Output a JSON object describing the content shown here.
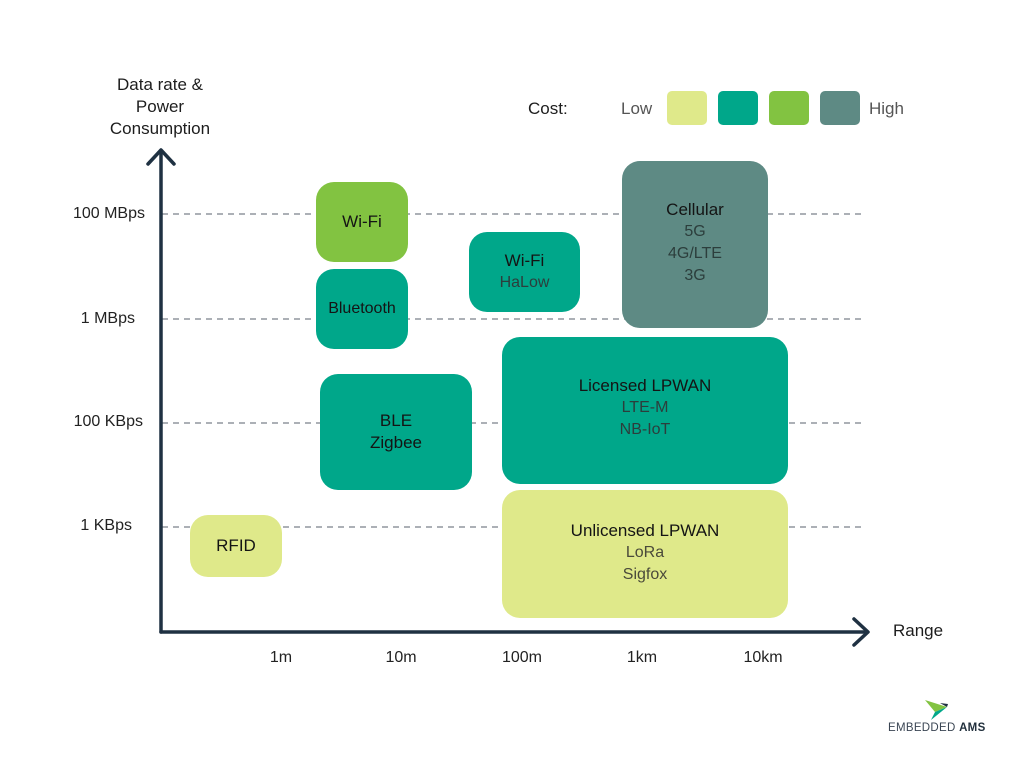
{
  "axes": {
    "y_label": [
      "Data rate &",
      "Power",
      "Consumption"
    ],
    "x_label": "Range",
    "y_ticks": [
      "100 MBps",
      "1 MBps",
      "100 KBps",
      "1 KBps"
    ],
    "x_ticks": [
      "1m",
      "10m",
      "100m",
      "1km",
      "10km"
    ]
  },
  "legend": {
    "title": "Cost:",
    "low_label": "Low",
    "high_label": "High",
    "colors": [
      "#dfe98a",
      "#00a78a",
      "#82c341",
      "#5e8a84"
    ]
  },
  "technologies": [
    {
      "name": "Wi-Fi",
      "subs": [],
      "cost_level": 3,
      "color": "#82c341"
    },
    {
      "name": "Bluetooth",
      "subs": [],
      "cost_level": 2,
      "color": "#00a78a"
    },
    {
      "name": "Wi-Fi",
      "subs": [
        "HaLow"
      ],
      "cost_level": 2,
      "color": "#00a78a"
    },
    {
      "name": "Cellular",
      "subs": [
        "5G",
        "4G/LTE",
        "3G"
      ],
      "cost_level": 4,
      "color": "#5e8a84"
    },
    {
      "name": "BLE",
      "subs": [
        "Zigbee"
      ],
      "cost_level": 2,
      "color": "#00a78a",
      "title_lines": [
        "BLE",
        "Zigbee"
      ]
    },
    {
      "name": "Licensed LPWAN",
      "subs": [
        "LTE-M",
        "NB-IoT"
      ],
      "cost_level": 2,
      "color": "#00a78a"
    },
    {
      "name": "RFID",
      "subs": [],
      "cost_level": 1,
      "color": "#dfe98a"
    },
    {
      "name": "Unlicensed LPWAN",
      "subs": [
        "LoRa",
        "Sigfox"
      ],
      "cost_level": 1,
      "color": "#dfe98a"
    }
  ],
  "brand": {
    "name_light": "EMBEDDED",
    "name_bold": "AMS"
  }
}
